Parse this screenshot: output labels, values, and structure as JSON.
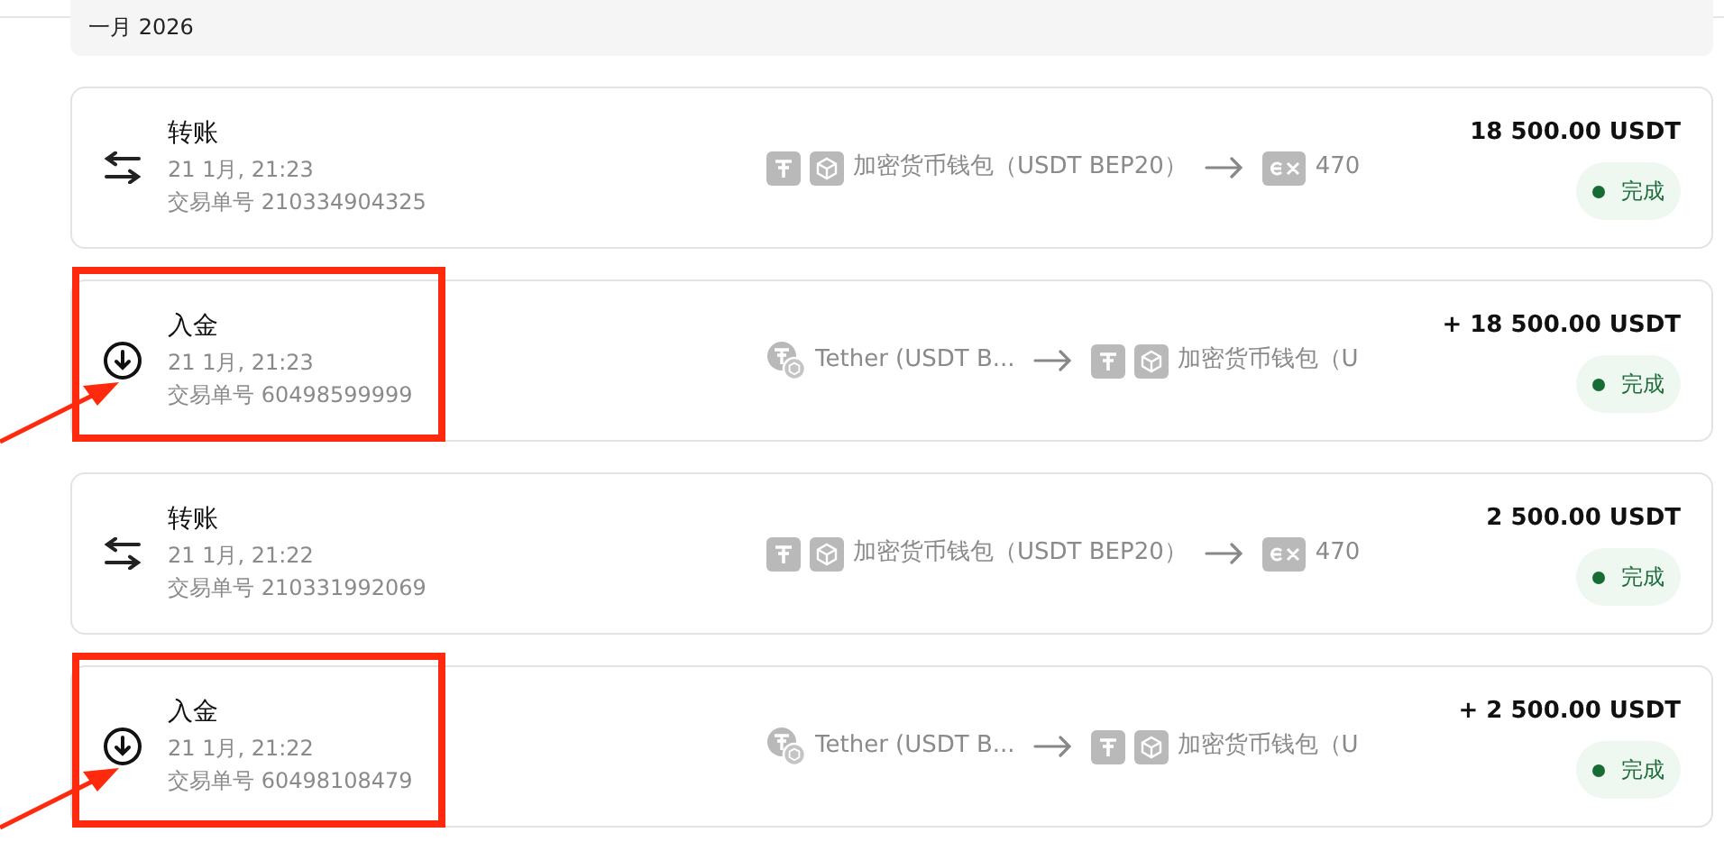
{
  "month_header": "一月 2026",
  "transactions": [
    {
      "kind": "transfer",
      "title": "转账",
      "time": "21 1月, 21:23",
      "order": "交易单号 210334904325",
      "from": {
        "kind": "wallet",
        "label": "加密货币钱包（USDT BEP20）"
      },
      "to": {
        "kind": "exchange",
        "label": "470"
      },
      "amount": "18 500.00 USDT",
      "status": "完成",
      "highlighted": false
    },
    {
      "kind": "deposit",
      "title": "入金",
      "time": "21 1月, 21:23",
      "order": "交易单号 60498599999",
      "from": {
        "kind": "coin",
        "label": "Tether (USDT B..."
      },
      "to": {
        "kind": "wallet",
        "label": "加密货币钱包（U"
      },
      "amount": "+ 18 500.00 USDT",
      "status": "完成",
      "highlighted": true
    },
    {
      "kind": "transfer",
      "title": "转账",
      "time": "21 1月, 21:22",
      "order": "交易单号 210331992069",
      "from": {
        "kind": "wallet",
        "label": "加密货币钱包（USDT BEP20）"
      },
      "to": {
        "kind": "exchange",
        "label": "470"
      },
      "amount": "2 500.00 USDT",
      "status": "完成",
      "highlighted": false
    },
    {
      "kind": "deposit",
      "title": "入金",
      "time": "21 1月, 21:22",
      "order": "交易单号 60498108479",
      "from": {
        "kind": "coin",
        "label": "Tether (USDT B..."
      },
      "to": {
        "kind": "wallet",
        "label": "加密货币钱包（U"
      },
      "amount": "+ 2 500.00 USDT",
      "status": "完成",
      "highlighted": true
    }
  ]
}
